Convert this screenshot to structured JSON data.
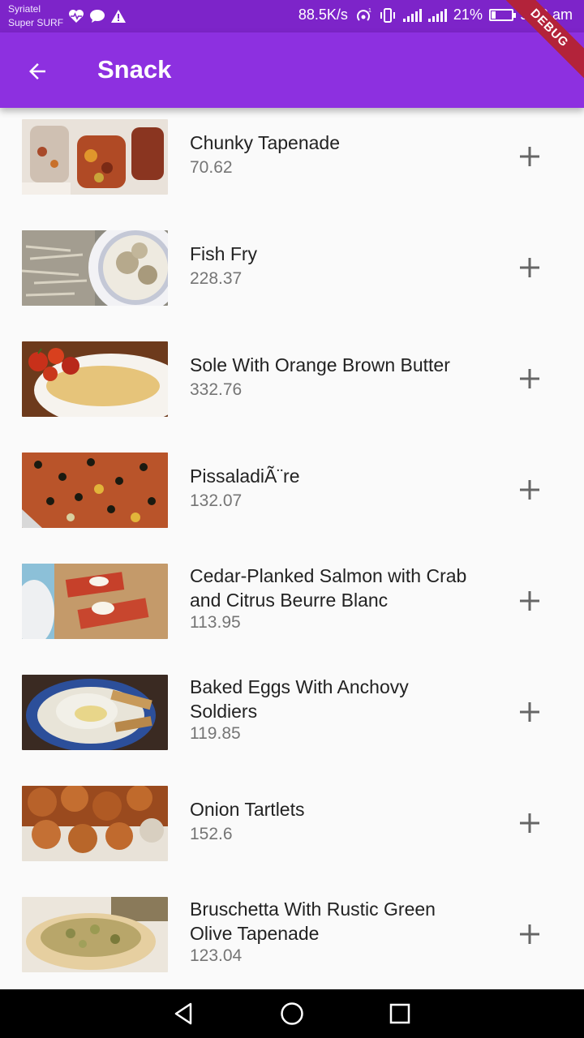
{
  "status_bar": {
    "carrier_line1": "Syriatel",
    "carrier_line2": "Super SURF",
    "speed": "88.5K/s",
    "battery": "21%",
    "battery_level": 0.21,
    "time": "9:09 am",
    "icons": [
      "heart-pulse-icon",
      "chat-icon",
      "warning-icon",
      "hotspot-icon",
      "vibrate-icon",
      "signal-icon",
      "4g-signal-icon",
      "battery-icon"
    ]
  },
  "app_bar": {
    "title": "Snack",
    "back_icon": "arrow-back-icon"
  },
  "debug_ribbon": "DEBUG",
  "items": [
    {
      "name": "Chunky Tapenade",
      "price": "70.62"
    },
    {
      "name": "Fish Fry",
      "price": "228.37"
    },
    {
      "name": "Sole With Orange Brown Butter",
      "price": "332.76"
    },
    {
      "name": "PissaladiÃ¨re",
      "price": "132.07"
    },
    {
      "name": "Cedar-Planked Salmon with Crab and Citrus Beurre Blanc",
      "price": "113.95"
    },
    {
      "name": "Baked Eggs With Anchovy Soldiers",
      "price": "119.85"
    },
    {
      "name": "Onion Tartlets",
      "price": "152.6"
    },
    {
      "name": "Bruschetta With Rustic Green Olive Tapenade",
      "price": "123.04"
    }
  ],
  "colors": {
    "app_bar": "#8d30e0",
    "status_bar": "#7d24c9",
    "background": "#fafafa",
    "debug": "#b3233a"
  }
}
